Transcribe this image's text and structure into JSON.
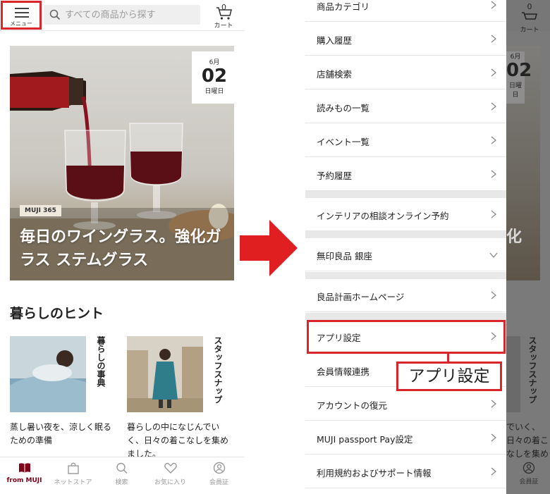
{
  "left": {
    "header": {
      "menu_label": "メニュー",
      "search_placeholder": "すべての商品から探す",
      "cart_count": "0",
      "cart_label": "カート"
    },
    "hero": {
      "month": "6月",
      "day": "02",
      "weekday": "日曜日",
      "badge": "MUJI 365",
      "title": "毎日のワイングラス。強化ガラス ステムグラス"
    },
    "section_title": "暮らしのヒント",
    "cards": [
      {
        "tag": "暮らしの事典",
        "caption": "蒸し暑い夜を、涼しく眠るための準備"
      },
      {
        "tag": "スタッフスナップ",
        "caption": "暮らしの中になじんでいく、日々の着こなしを集めました。"
      }
    ],
    "tabbar": [
      {
        "label": "from MUJI",
        "icon": "book-icon"
      },
      {
        "label": "ネットストア",
        "icon": "bag-icon"
      },
      {
        "label": "検索",
        "icon": "search-icon"
      },
      {
        "label": "お気に入り",
        "icon": "heart-icon"
      },
      {
        "label": "会員証",
        "icon": "member-icon"
      }
    ]
  },
  "right": {
    "menu_items": [
      {
        "label": "商品カテゴリ"
      },
      {
        "label": "購入履歴"
      },
      {
        "label": "店舗検索"
      },
      {
        "label": "読みもの一覧"
      },
      {
        "label": "イベント一覧"
      },
      {
        "label": "予約履歴"
      },
      {
        "label": "インテリアの相談オンライン予約"
      },
      {
        "label": "無印良品 銀座"
      },
      {
        "label": "良品計画ホームページ"
      },
      {
        "label": "アプリ設定"
      },
      {
        "label": "会員情報連携"
      },
      {
        "label": "アカウントの復元"
      },
      {
        "label": "MUJI passport Pay設定"
      },
      {
        "label": "利用規約およびサポート情報"
      }
    ],
    "callout": "アプリ設定",
    "background": {
      "cart_count": "0",
      "cart_label": "カート",
      "hero_month": "6月",
      "hero_day": "02",
      "hero_weekday": "日曜日",
      "hero_title_fragment": "化",
      "card_tag": "スタッフスナップ",
      "card_caption": "でいく、日々の着こなしを集め",
      "tab_label": "会員証"
    }
  },
  "colors": {
    "accent_red": "#d9262c",
    "muji_burgundy": "#7f0019",
    "arrow_red": "#e02020"
  }
}
